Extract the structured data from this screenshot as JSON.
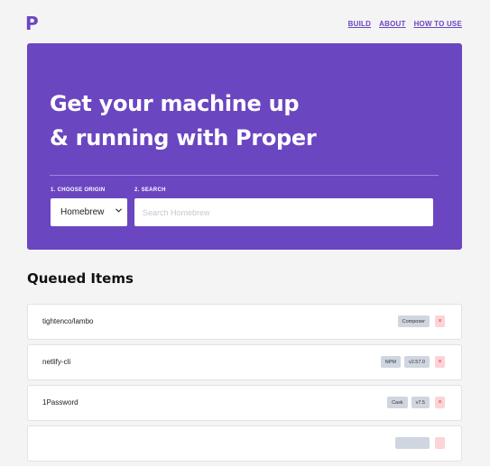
{
  "logo": "P",
  "nav": [
    {
      "label": "BUILD"
    },
    {
      "label": "ABOUT"
    },
    {
      "label": "HOW TO USE"
    }
  ],
  "hero": {
    "title_line1": "Get your machine up",
    "title_line2": "& running with Proper",
    "origin_label": "1. CHOOSE ORIGIN",
    "origin_value": "Homebrew",
    "search_label": "2. SEARCH",
    "search_placeholder": "Search Homebrew",
    "search_value": ""
  },
  "queued": {
    "title": "Queued Items",
    "remove_glyph": "×",
    "items": [
      {
        "name": "tightenco/lambo",
        "tags": [
          "Composer"
        ]
      },
      {
        "name": "netlify-cli",
        "tags": [
          "NPM",
          "v2.57.0"
        ]
      },
      {
        "name": "1Password",
        "tags": [
          "Cask",
          "v7.5"
        ]
      }
    ]
  },
  "colors": {
    "brand": "#6b46c1",
    "remove_bg": "#fcd3d7",
    "remove_fg": "#e3342f",
    "tag_bg": "#cfd6df"
  }
}
